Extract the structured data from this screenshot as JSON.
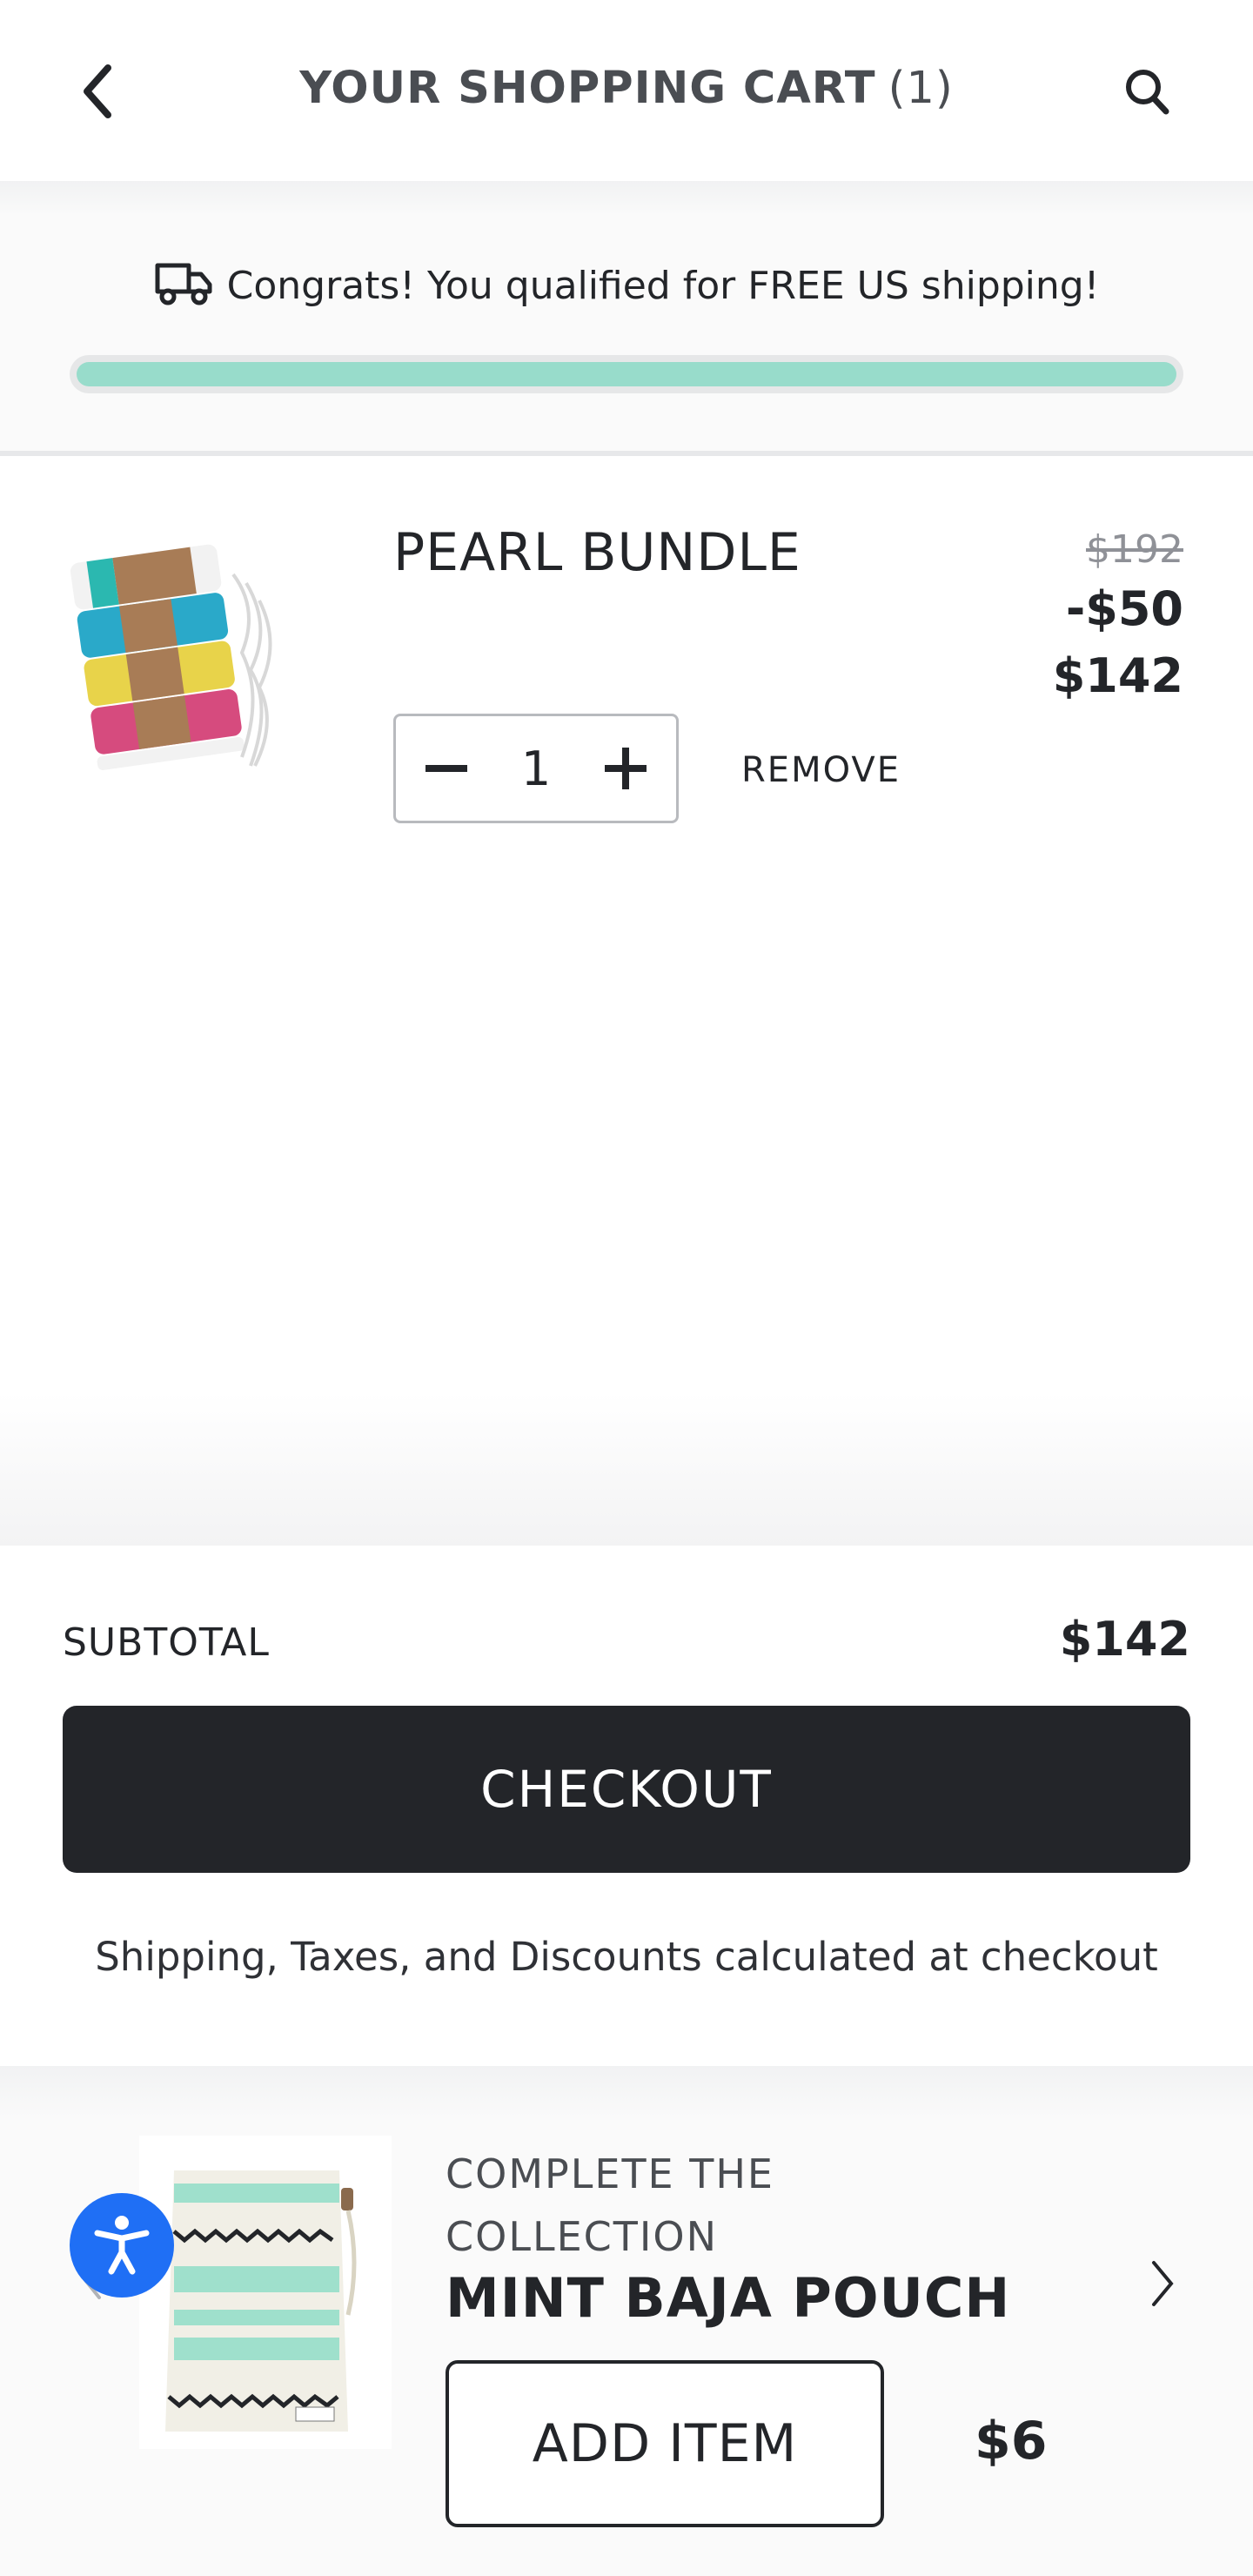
{
  "header": {
    "title": "YOUR SHOPPING CART",
    "count": "(1)",
    "back_icon": "chevron-left-icon",
    "search_icon": "search-icon"
  },
  "shipping": {
    "message": "Congrats! You qualified for FREE US shipping!",
    "icon": "truck-icon",
    "progress_percent": 100,
    "progress_color": "#98dccb"
  },
  "cart_item": {
    "name": "PEARL BUNDLE",
    "original_price": "$192",
    "discount": "-$50",
    "price": "$142",
    "quantity": "1",
    "remove_label": "REMOVE"
  },
  "summary": {
    "subtotal_label": "SUBTOTAL",
    "subtotal_value": "$142",
    "checkout_label": "CHECKOUT",
    "note": "Shipping, Taxes, and Discounts calculated at checkout"
  },
  "upsell": {
    "eyebrow": "COMPLETE THE COLLECTION",
    "name": "MINT BAJA POUCH",
    "add_label": "ADD ITEM",
    "price": "$6"
  },
  "colors": {
    "dark": "#232529",
    "accent_progress": "#98dccb",
    "accessibility_blue": "#1f6ff5"
  }
}
